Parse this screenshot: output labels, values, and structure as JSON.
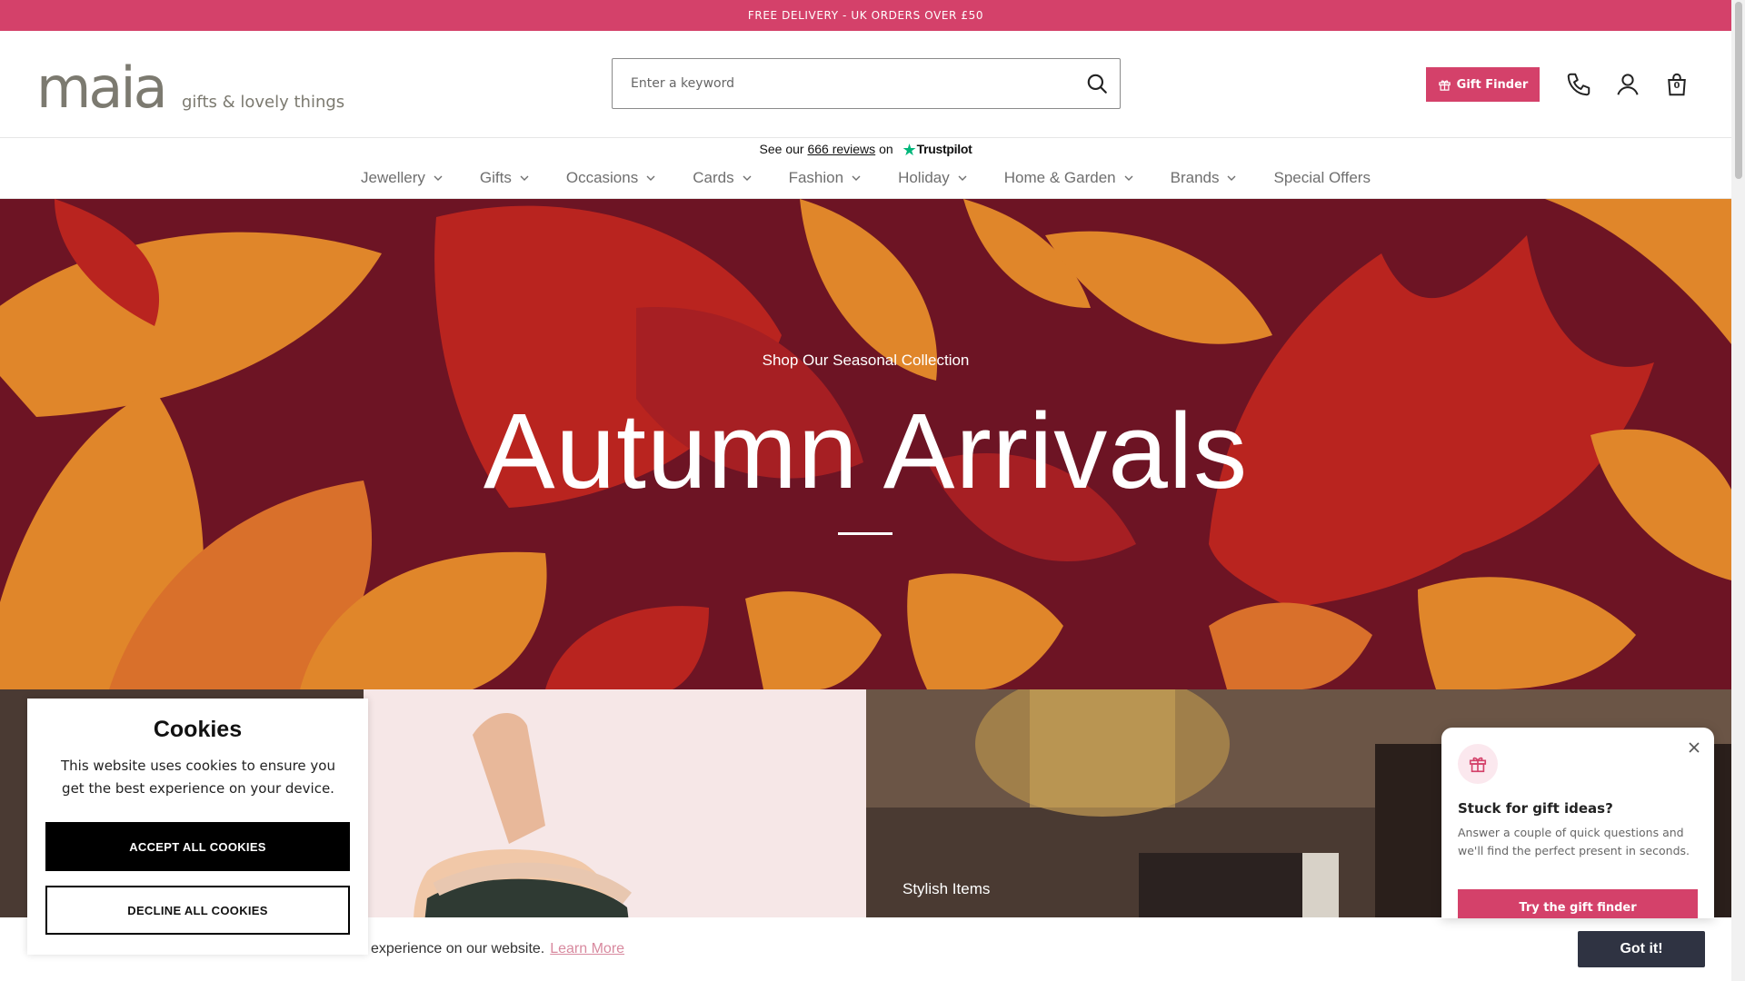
{
  "announcement": {
    "text": "FREE DELIVERY - UK ORDERS OVER £50"
  },
  "header": {
    "logo_word": "maia",
    "logo_tagline": "gifts & lovely things",
    "search_placeholder": "Enter a keyword",
    "gift_finder_label": "Gift Finder",
    "cart_count": "0",
    "icons": [
      "search-icon",
      "gift-icon",
      "phone-icon",
      "account-icon",
      "bag-icon"
    ]
  },
  "trustpilot": {
    "prefix": "See our",
    "reviews_link": "666 reviews",
    "middle": "on",
    "brand": "Trustpilot"
  },
  "nav": {
    "items": [
      {
        "label": "Jewellery",
        "has_dropdown": true
      },
      {
        "label": "Gifts",
        "has_dropdown": true
      },
      {
        "label": "Occasions",
        "has_dropdown": true
      },
      {
        "label": "Cards",
        "has_dropdown": true
      },
      {
        "label": "Fashion",
        "has_dropdown": true
      },
      {
        "label": "Holiday",
        "has_dropdown": true
      },
      {
        "label": "Home & Garden",
        "has_dropdown": true
      },
      {
        "label": "Brands",
        "has_dropdown": true
      },
      {
        "label": "Special Offers",
        "has_dropdown": false
      }
    ]
  },
  "hero": {
    "subtitle": "Shop Our Seasonal Collection",
    "title": "Autumn Arrivals"
  },
  "tiles": {
    "right_label": "Stylish Items"
  },
  "cookie_modal": {
    "title": "Cookies",
    "text": "This website uses cookies to ensure you get the best experience on your device.",
    "accept_label": "ACCEPT ALL COOKIES",
    "decline_label": "DECLINE ALL COOKIES"
  },
  "cookie_bar": {
    "text": "experience on our website.",
    "learn_more": "Learn More",
    "button_label": "Got it!"
  },
  "gift_popup": {
    "title": "Stuck for gift ideas?",
    "text": "Answer a couple of quick questions and we'll find the perfect present in seconds.",
    "button_label": "Try the gift finder"
  },
  "colors": {
    "brand_pink": "#d4416a",
    "hero_dark": "#6d1424",
    "hero_orange": "#e0862a",
    "hero_red": "#b9241f",
    "logo_grey": "#7c7a70",
    "got_it_bg": "#2f3342",
    "trustpilot_green": "#00b67a"
  }
}
